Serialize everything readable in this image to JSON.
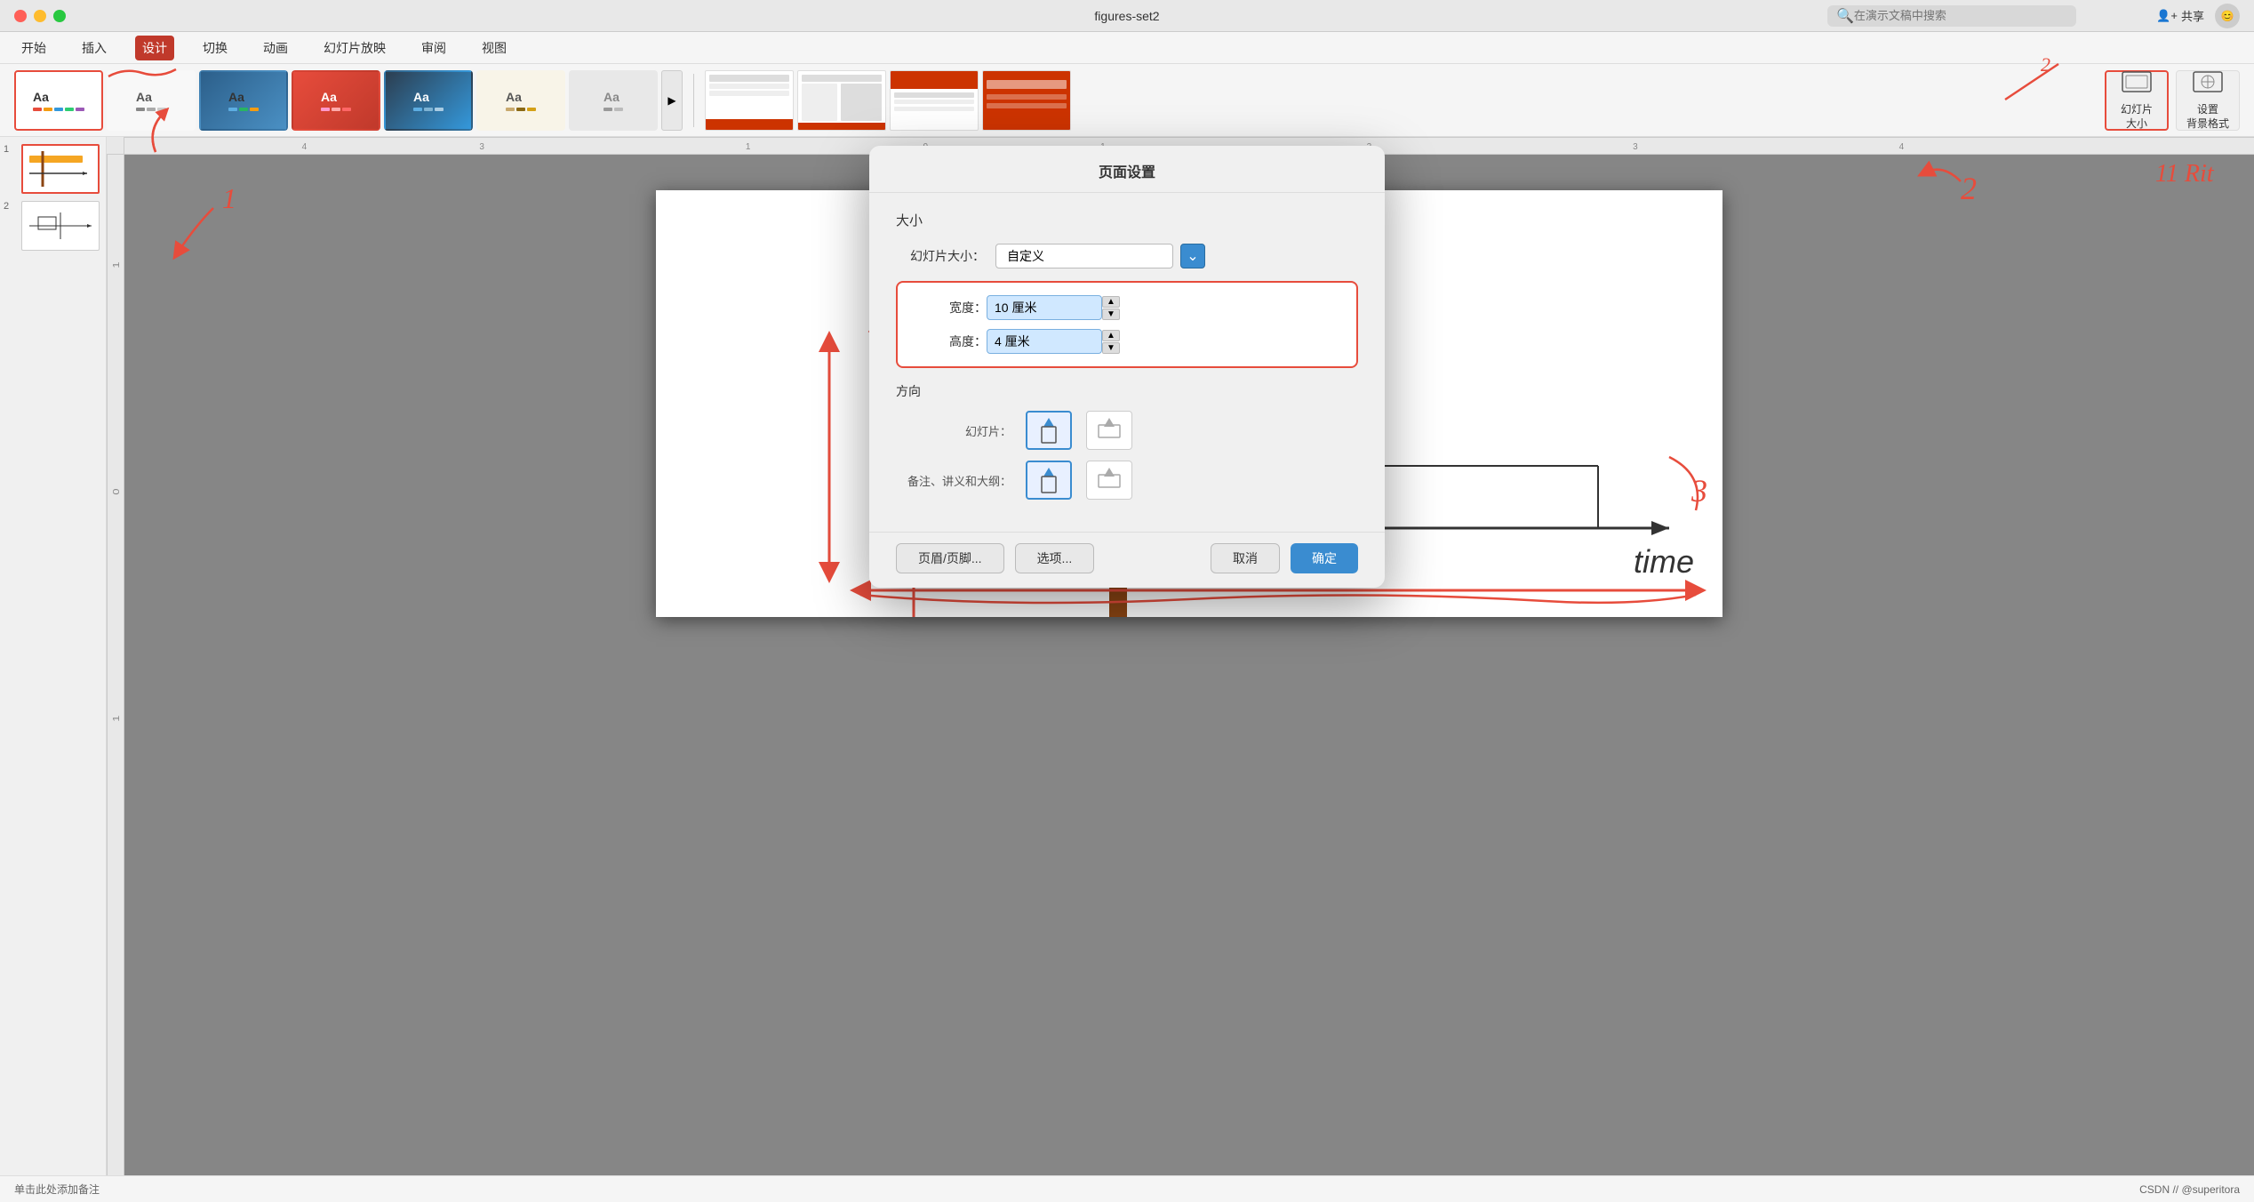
{
  "titlebar": {
    "title": "figures-set2",
    "search_placeholder": "在演示文稿中搜索",
    "share_label": "共享",
    "profile_icon": "👤"
  },
  "menubar": {
    "items": [
      {
        "id": "start",
        "label": "开始"
      },
      {
        "id": "insert",
        "label": "插入"
      },
      {
        "id": "design",
        "label": "设计",
        "active": true
      },
      {
        "id": "transition",
        "label": "切换"
      },
      {
        "id": "animation",
        "label": "动画"
      },
      {
        "id": "slideshow",
        "label": "幻灯片放映"
      },
      {
        "id": "review",
        "label": "审阅"
      },
      {
        "id": "view",
        "label": "视图"
      }
    ]
  },
  "toolbar": {
    "themes": [
      {
        "id": "t1",
        "label": "Aa",
        "selected": true
      },
      {
        "id": "t2",
        "label": "Aa"
      },
      {
        "id": "t3",
        "label": "Aa"
      },
      {
        "id": "t4",
        "label": "Aa"
      },
      {
        "id": "t5",
        "label": "Aa"
      },
      {
        "id": "t6",
        "label": "Aa"
      },
      {
        "id": "t7",
        "label": "Aa"
      }
    ],
    "more_label": "▶",
    "slide_size_label": "幻灯片\n大小",
    "bg_format_label": "设置\n背景格式"
  },
  "slides": [
    {
      "num": 1,
      "active": true
    },
    {
      "num": 2,
      "active": false
    }
  ],
  "dialog": {
    "title": "页面设置",
    "size_section_label": "大小",
    "size_field_label": "幻灯片大小：",
    "size_value": "自定义",
    "width_label": "宽度：",
    "width_value": "10 厘米",
    "height_label": "高度：",
    "height_value": "4 厘米",
    "direction_section_label": "方向",
    "slide_direction_label": "幻灯片：",
    "notes_direction_label": "备注、讲义和大纲：",
    "btn_header_footer": "页眉/页脚...",
    "btn_options": "选项...",
    "btn_cancel": "取消",
    "btn_ok": "确定"
  },
  "statusbar": {
    "text": "单击此处添加备注",
    "right_text": "CSDN // @superitora"
  },
  "annotations": {
    "label_1": "1",
    "label_2": "2",
    "label_3": "3",
    "circle_note": "11 Rit"
  }
}
